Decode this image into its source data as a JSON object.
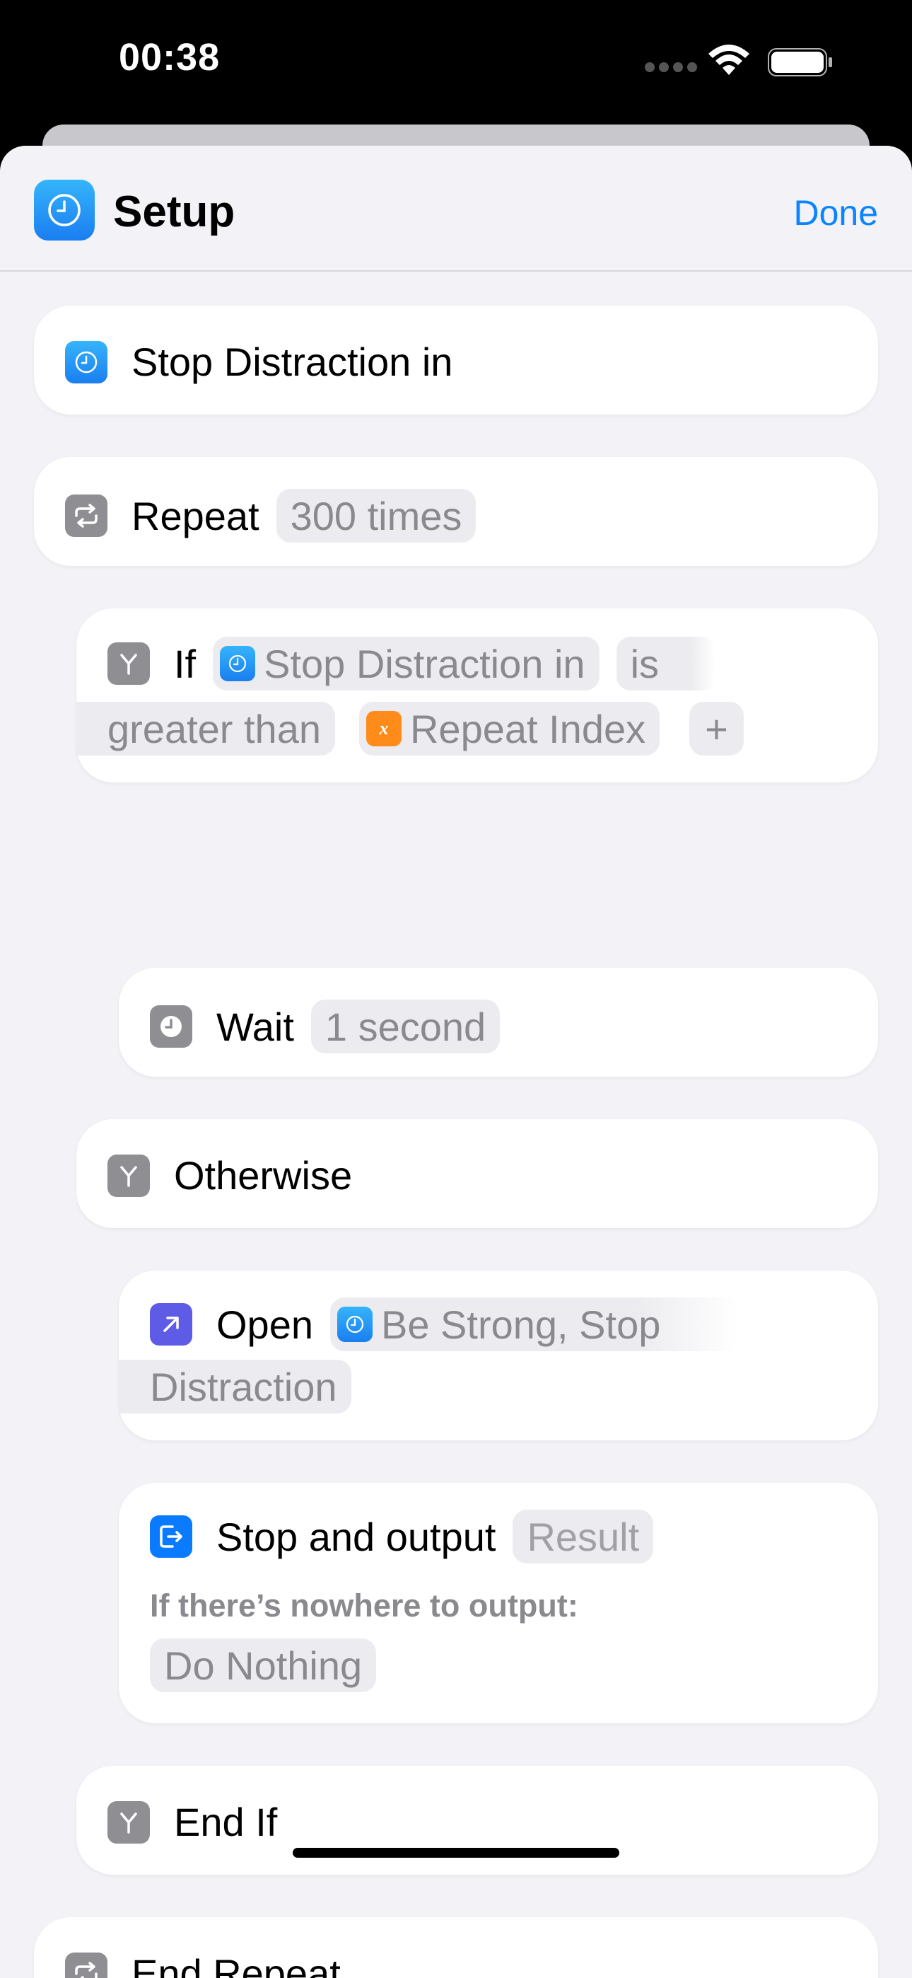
{
  "status_bar": {
    "time": "00:38"
  },
  "nav": {
    "title": "Setup",
    "done_label": "Done"
  },
  "actions": {
    "stop_distraction": {
      "label": "Stop Distraction in"
    },
    "repeat": {
      "label": "Repeat",
      "count_token": "300 times"
    },
    "if": {
      "label": "If",
      "variable_token": "Stop Distraction in",
      "is_word": "is",
      "condition_token": "greater than",
      "compare_token": "Repeat Index",
      "add_label": "+"
    },
    "wait": {
      "label": "Wait",
      "duration_token": "1 second"
    },
    "otherwise": {
      "label": "Otherwise"
    },
    "open": {
      "label": "Open",
      "app_token_line1": "Be Strong, Stop",
      "app_token_line2": "Distraction"
    },
    "stop_output": {
      "label": "Stop and output",
      "result_token": "Result",
      "fallback_label": "If there’s nowhere to output:",
      "fallback_token": "Do Nothing"
    },
    "end_if": {
      "label": "End If"
    },
    "end_repeat": {
      "label": "End Repeat"
    }
  },
  "icons": {
    "app": "clock-icon",
    "repeat": "repeat-icon",
    "if": "branch-icon",
    "wait": "clock-icon",
    "open": "open-arrow-icon",
    "stop_output": "exit-icon",
    "variable": "variable-x-icon"
  },
  "colors": {
    "accent": "#0a84ff",
    "background": "#f2f2f7",
    "variable_orange": "#ff8c1a",
    "open_purple": "#5e5ce6"
  }
}
